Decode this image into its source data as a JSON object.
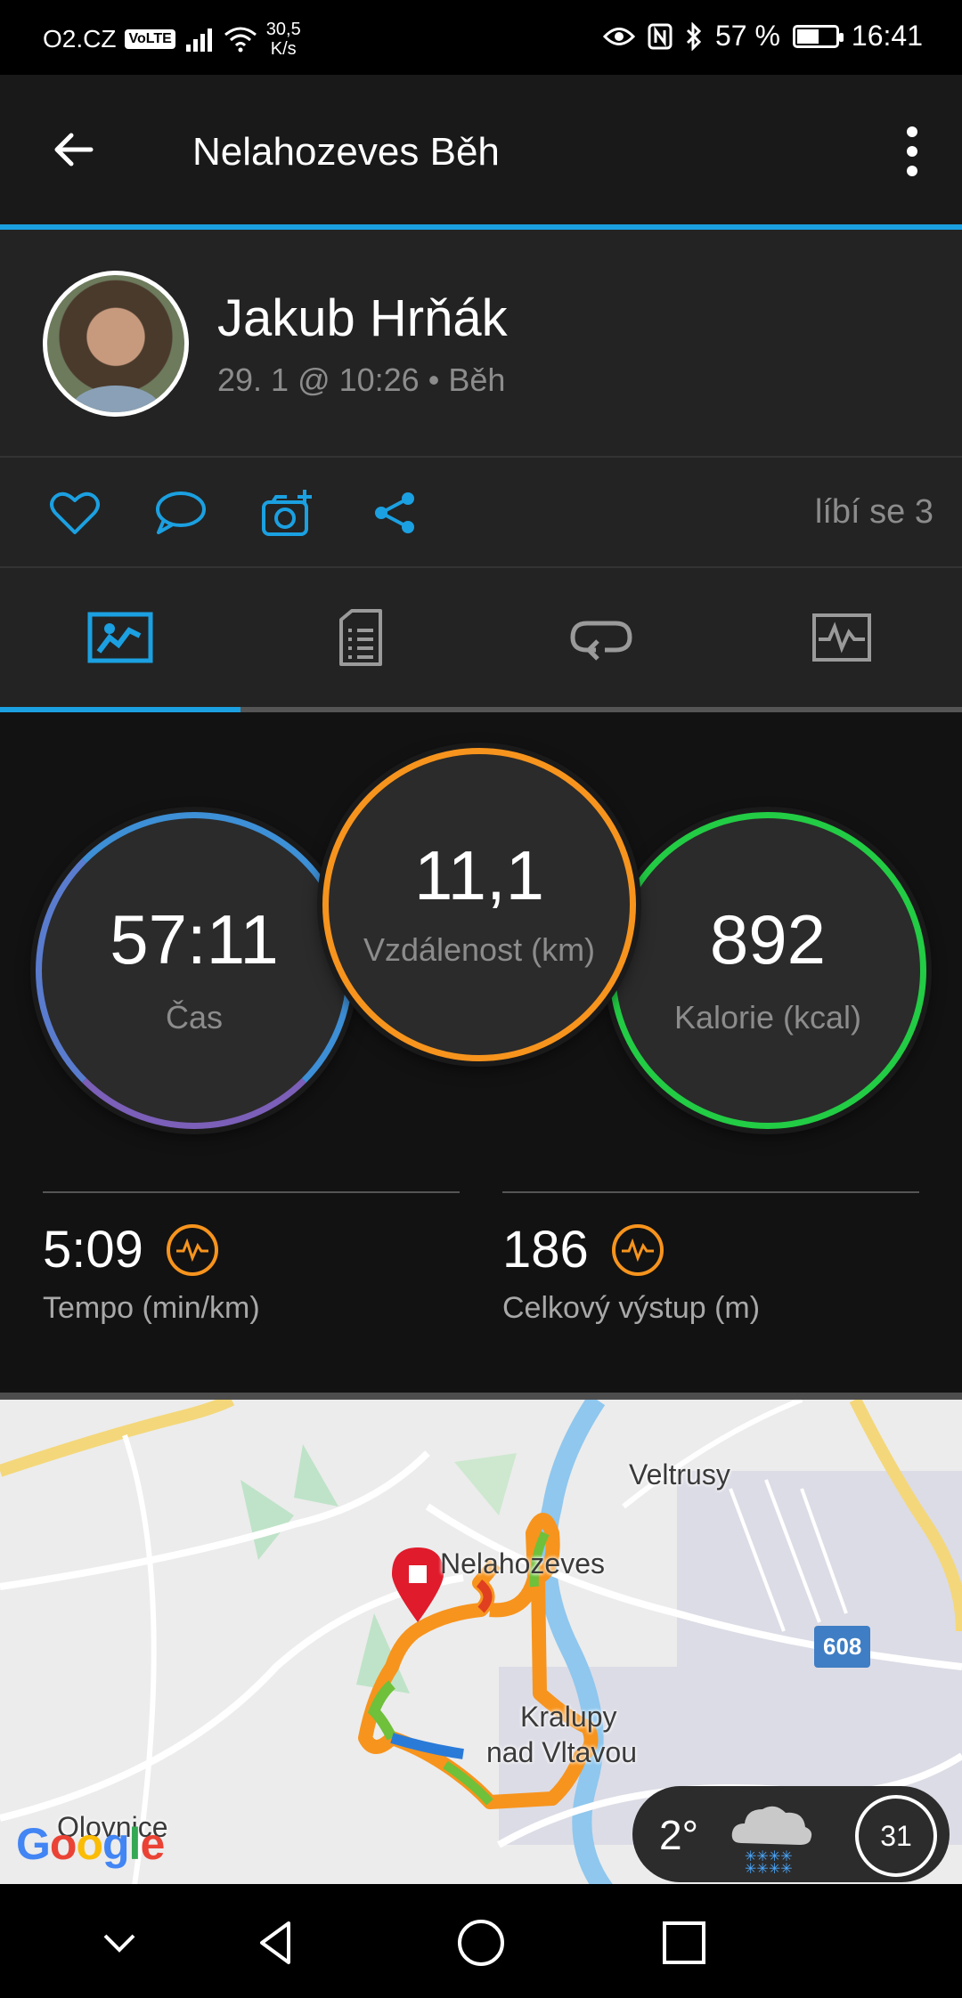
{
  "status_bar": {
    "carrier": "O2.CZ",
    "volte": "VoLTE",
    "net_speed_value": "30,5",
    "net_speed_unit": "K/s",
    "battery": "57 %",
    "battery_level": 0.57,
    "time": "16:41"
  },
  "app_bar": {
    "title": "Nelahozeves Běh"
  },
  "profile": {
    "name": "Jakub Hrňák",
    "meta": "29. 1 @ 10:26 • Běh"
  },
  "actions": {
    "likes": "líbí se 3"
  },
  "tabs": {
    "selected_index": 0,
    "items": [
      "overview-tab",
      "details-tab",
      "laps-tab",
      "charts-tab"
    ]
  },
  "stats": {
    "time": {
      "value": "57:11",
      "label": "Čas"
    },
    "distance": {
      "value": "11,1",
      "label": "Vzdálenost (km)"
    },
    "calories": {
      "value": "892",
      "label": "Kalorie (kcal)"
    },
    "pace": {
      "value": "5:09",
      "label": "Tempo (min/km)"
    },
    "elevation": {
      "value": "186",
      "label": "Celkový výstup (m)"
    }
  },
  "map": {
    "labels": {
      "veltrusy": "Veltrusy",
      "nelahozeves": "Nelahozeves",
      "kralupy_1": "Kralupy",
      "kralupy_2": "nad Vltavou",
      "olovnice": "Olovnice"
    },
    "road_number": "608",
    "google": "Google"
  },
  "weather": {
    "temperature": "2°",
    "wind": "31"
  },
  "colors": {
    "accent": "#1ba0e1",
    "distance_ring": "#f7941d",
    "calories_ring": "#22cc44",
    "time_ring": "#3d8fd6"
  }
}
